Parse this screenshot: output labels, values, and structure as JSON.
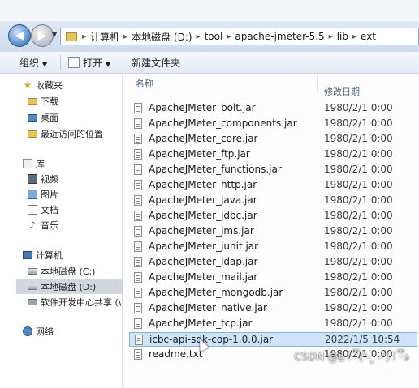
{
  "address": {
    "segments": [
      "计算机",
      "本地磁盘 (D:)",
      "tool",
      "apache-jmeter-5.5",
      "lib",
      "ext"
    ]
  },
  "toolbar": {
    "organize": "组织",
    "open": "打开",
    "new_folder": "新建文件夹"
  },
  "nav": {
    "favorites": "收藏夹",
    "downloads": "下载",
    "desktop": "桌面",
    "recent": "最近访问的位置",
    "libraries": "库",
    "videos": "视频",
    "pictures": "图片",
    "documents": "文档",
    "music": "音乐",
    "computer": "计算机",
    "drive_c": "本地磁盘 (C:)",
    "drive_d": "本地磁盘 (D:)",
    "share": "软件开发中心共享 (\\",
    "network": "网络"
  },
  "columns": {
    "name": "名称",
    "modified": "修改日期"
  },
  "files": [
    {
      "name": "ApacheJMeter_bolt.jar",
      "date": "1980/2/1 0:00"
    },
    {
      "name": "ApacheJMeter_components.jar",
      "date": "1980/2/1 0:00"
    },
    {
      "name": "ApacheJMeter_core.jar",
      "date": "1980/2/1 0:00"
    },
    {
      "name": "ApacheJMeter_ftp.jar",
      "date": "1980/2/1 0:00"
    },
    {
      "name": "ApacheJMeter_functions.jar",
      "date": "1980/2/1 0:00"
    },
    {
      "name": "ApacheJMeter_http.jar",
      "date": "1980/2/1 0:00"
    },
    {
      "name": "ApacheJMeter_java.jar",
      "date": "1980/2/1 0:00"
    },
    {
      "name": "ApacheJMeter_jdbc.jar",
      "date": "1980/2/1 0:00"
    },
    {
      "name": "ApacheJMeter_jms.jar",
      "date": "1980/2/1 0:00"
    },
    {
      "name": "ApacheJMeter_junit.jar",
      "date": "1980/2/1 0:00"
    },
    {
      "name": "ApacheJMeter_ldap.jar",
      "date": "1980/2/1 0:00"
    },
    {
      "name": "ApacheJMeter_mail.jar",
      "date": "1980/2/1 0:00"
    },
    {
      "name": "ApacheJMeter_mongodb.jar",
      "date": "1980/2/1 0:00"
    },
    {
      "name": "ApacheJMeter_native.jar",
      "date": "1980/2/1 0:00"
    },
    {
      "name": "ApacheJMeter_tcp.jar",
      "date": "1980/2/1 0:00"
    },
    {
      "name": "icbc-api-sdk-cop-1.0.0.jar",
      "date": "2022/1/5 10:54"
    },
    {
      "name": "readme.txt",
      "date": "1980/2/1 0:00"
    }
  ],
  "watermark": "CSDN @໒꒰ྀི(ᐡ- ̫ -ᐡ)꒱ྀིა"
}
